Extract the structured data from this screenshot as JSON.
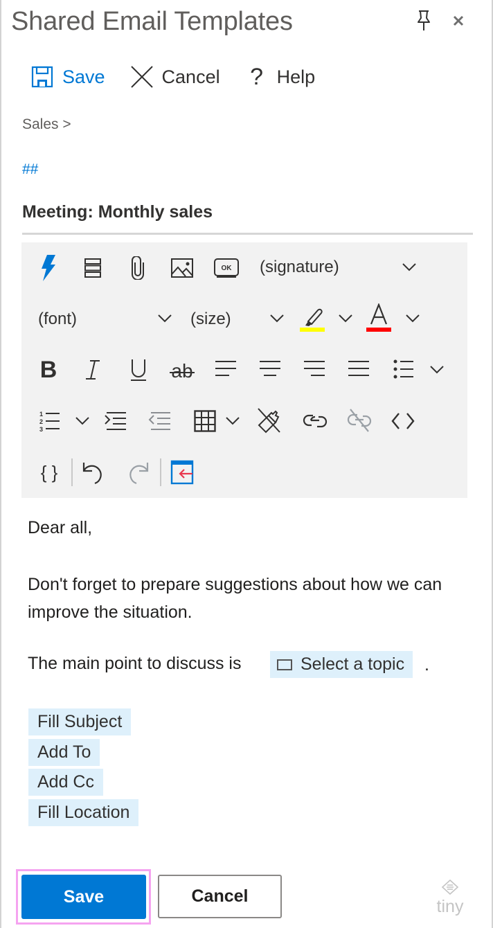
{
  "window": {
    "title": "Shared Email Templates",
    "pin_icon": "pin-icon",
    "close_icon": "close-icon"
  },
  "commandbar": {
    "save_label": "Save",
    "cancel_label": "Cancel",
    "help_label": "Help"
  },
  "breadcrumb": "Sales >",
  "hashtag": "##",
  "subject": "Meeting: Monthly sales",
  "toolbar": {
    "signature_dropdown": "(signature)",
    "font_dropdown": "(font)",
    "size_dropdown": "(size)",
    "highlight_color": "#ffff00",
    "text_color": "#ff0000",
    "rows": [
      [
        "quick-insert",
        "insert-template",
        "attach-file",
        "insert-image",
        "insert-button",
        "signature"
      ],
      [
        "font",
        "size",
        "highlight-color",
        "text-color"
      ],
      [
        "bold",
        "italic",
        "underline",
        "strikethrough",
        "align-left",
        "align-center",
        "align-right",
        "justify",
        "bullet-list"
      ],
      [
        "numbered-list",
        "indent",
        "outdent",
        "table",
        "clear-formatting",
        "insert-link",
        "remove-link",
        "source-code"
      ],
      [
        "macros",
        "undo",
        "redo",
        "insert-field"
      ]
    ]
  },
  "email_body": {
    "greeting": "Dear all,",
    "paragraph": "Don't forget to prepare suggestions about how we can improve the situation.",
    "topic_prefix": "The main point to discuss is",
    "topic_placeholder": "Select a topic",
    "topic_suffix": ".",
    "macros": [
      "Fill Subject",
      "Add To",
      "Add Cc",
      "Fill Location"
    ]
  },
  "footer": {
    "save_label": "Save",
    "cancel_label": "Cancel",
    "branding": "tiny"
  },
  "colors": {
    "accent": "#0078d4",
    "chip_bg": "#def0fb",
    "toolbar_bg": "#f2f2f2",
    "focus_ring": "#f5a3f0"
  }
}
